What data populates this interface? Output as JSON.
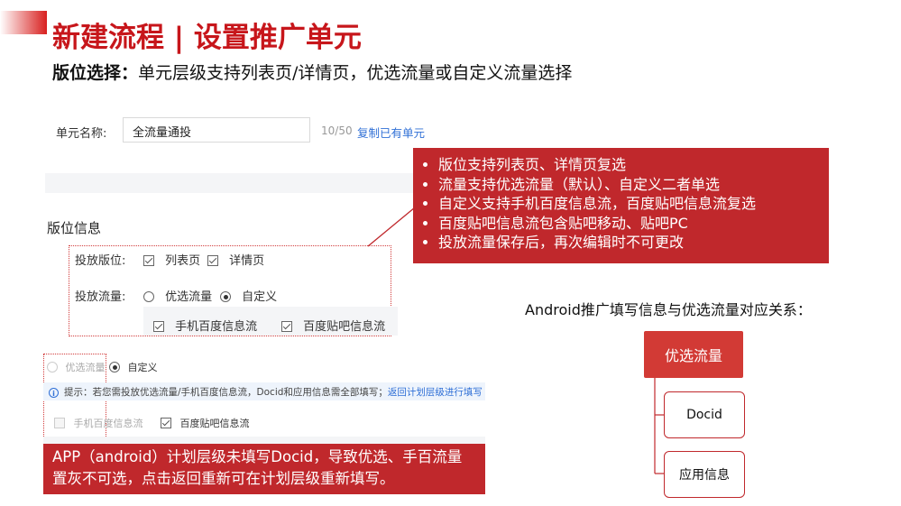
{
  "header": {
    "title": "新建流程 | 设置推广单元",
    "subtitle_bold": "版位选择：",
    "subtitle_rest": "单元层级支持列表页/详情页，优选流量或自定义流量选择"
  },
  "form": {
    "unit_name_label": "单元名称:",
    "unit_name_value": "全流量通投",
    "char_count": "10/50",
    "copy_link": "复制已有单元",
    "section_title": "版位信息",
    "placement_label": "投放版位:",
    "placement_options": [
      "列表页",
      "详情页"
    ],
    "traffic_label": "投放流量:",
    "traffic_options": [
      "优选流量",
      "自定义"
    ],
    "custom_options": [
      "手机百度信息流",
      "百度贴吧信息流"
    ]
  },
  "callout": {
    "items": [
      "版位支持列表页、详情页复选",
      "流量支持优选流量（默认）、自定义二者单选",
      "自定义支持手机百度信息流，百度贴吧信息流复选",
      "百度贴吧信息流包含贴吧移动、贴吧PC",
      "投放流量保存后，再次编辑时不可更改"
    ]
  },
  "second_form": {
    "traffic_options": [
      "优选流量",
      "自定义"
    ],
    "hint_prefix": "提示：若您需投放优选流量/手机百度信息流，Docid和应用信息需全部填写；",
    "hint_link": "返回计划层级进行填写",
    "custom_options": [
      "手机百度信息流",
      "百度贴吧信息流"
    ]
  },
  "bottom_note": "APP（android）计划层级未填写Docid，导致优选、手百流量置灰不可选，点击返回重新可在计划层级重新填写。",
  "relation": {
    "title": "Android推广填写信息与优选流量对应关系：",
    "root": "优选流量",
    "children": [
      "Docid",
      "应用信息"
    ]
  },
  "colors": {
    "brand_red": "#c7161b",
    "callout_red": "#c0282c",
    "link_blue": "#2f6fd6"
  }
}
